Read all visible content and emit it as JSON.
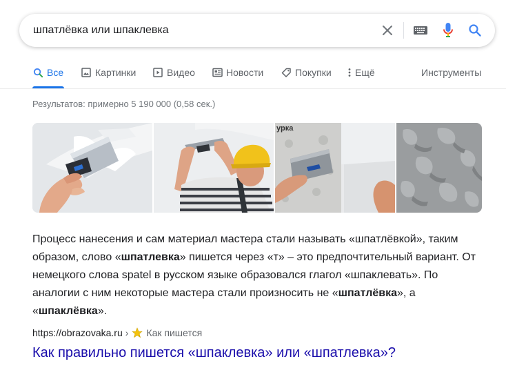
{
  "search": {
    "query": "шпатлёвка или шпаклевка",
    "clear_icon": "close-icon",
    "keyboard_icon": "keyboard-icon",
    "mic_icon": "microphone-icon",
    "search_icon": "search-icon"
  },
  "tabs": [
    {
      "label": "Все",
      "icon": "search-icon",
      "active": true
    },
    {
      "label": "Картинки",
      "icon": "image-icon"
    },
    {
      "label": "Видео",
      "icon": "video-icon"
    },
    {
      "label": "Новости",
      "icon": "news-icon"
    },
    {
      "label": "Покупки",
      "icon": "tag-icon"
    },
    {
      "label": "Ещё",
      "icon": "more-vert-icon"
    }
  ],
  "tools_label": "Инструменты",
  "stats": "Результатов: примерно 5 190 000 (0,58 сек.)",
  "images": [
    {
      "kind": "spatula-on-wall"
    },
    {
      "kind": "worker-yellow-helmet"
    },
    {
      "kind": "trowel-plaster",
      "caption": "урка"
    },
    {
      "kind": "textured-plaster"
    }
  ],
  "snippet": {
    "line1": "Процесс нанесения и сам материал мастера стали называть «шпатлёвкой», таким",
    "line2_pre": "образом, слово «",
    "line2_bold": "шпатлевка",
    "line2_post": "» пишется через «т» – это предпочтительный вариант. От",
    "line3": "немецкого слова spatel в русском языке образовался глагол «шпаклевать». По",
    "line4_pre": "аналогии с ним некоторые мастера стали произносить не «",
    "line4_bold": "шпатлёвка",
    "line4_post": "», а",
    "line5_pre": "«",
    "line5_bold": "шпаклёвка",
    "line5_post": "»."
  },
  "result": {
    "url": "https://obrazovaka.ru",
    "separator": "›",
    "crumb": "Как пишется",
    "title": "Как правильно пишется «шпаклевка» или «шпатлевка»?"
  },
  "colors": {
    "link": "#1a0dab",
    "accent": "#1a73e8",
    "muted": "#70757a"
  }
}
